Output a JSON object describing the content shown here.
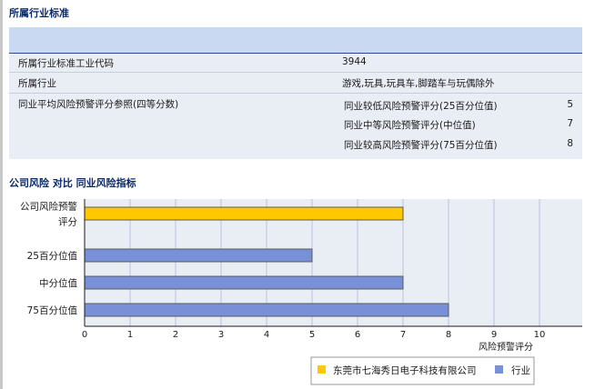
{
  "sections": {
    "industry_standard_title": "所属行业标准",
    "comparison_title": "公司风险 对比 同业风险指标"
  },
  "industry_table": {
    "rows": [
      {
        "label": "所属行业标准工业代码",
        "value": "3944"
      },
      {
        "label": "所属行业",
        "value": "游戏,玩具,玩具车,脚踏车与玩偶除外"
      }
    ],
    "benchmark": {
      "label": "同业平均风险预警评分参照(四等分数)",
      "items": [
        {
          "label": "同业较低风险预警评分(25百分位值)",
          "value": "5"
        },
        {
          "label": "同业中等风险预警评分(中位值)",
          "value": "7"
        },
        {
          "label": "同业较高风险预警评分(75百分位值)",
          "value": "8"
        }
      ]
    }
  },
  "chart_data": {
    "type": "bar",
    "orientation": "horizontal",
    "categories": [
      {
        "lines": [
          "公司风险预警",
          "评分"
        ],
        "value": 7,
        "series": "company"
      },
      {
        "lines": [
          "25百分位值"
        ],
        "value": 5,
        "series": "industry"
      },
      {
        "lines": [
          "中分位值"
        ],
        "value": 7,
        "series": "industry"
      },
      {
        "lines": [
          "75百分位值"
        ],
        "value": 8,
        "series": "industry"
      }
    ],
    "series": [
      {
        "key": "company",
        "name": "东莞市七海秀日电子科技有限公司",
        "color": "#ffc800"
      },
      {
        "key": "industry",
        "name": "行业",
        "color": "#7890d8"
      }
    ],
    "xlabel": "风险预警评分",
    "xlim": [
      0,
      11
    ],
    "xticks": [
      0,
      1,
      2,
      3,
      4,
      5,
      6,
      7,
      8,
      9,
      10
    ],
    "grid": true,
    "legend_position": "bottom-right",
    "plot_background": "#e9eef5",
    "gridline_color": "#b7c4dc"
  }
}
